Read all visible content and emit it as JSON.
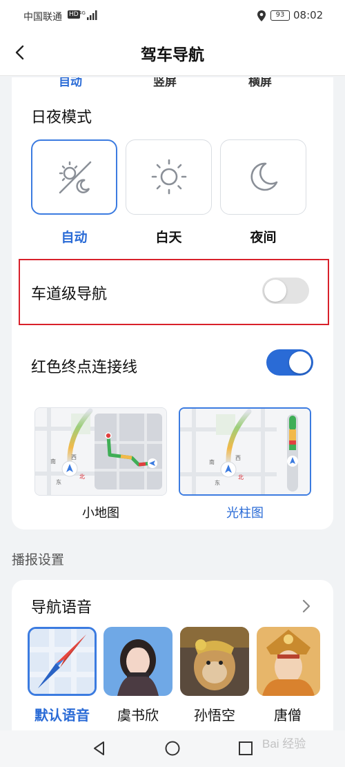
{
  "status_bar": {
    "carrier": "中国联通",
    "hd": "HD",
    "battery": "93",
    "time": "08:02"
  },
  "header": {
    "title": "驾车导航"
  },
  "card1": {
    "cut_labels": [
      "自动",
      "竖屏",
      "横屏"
    ],
    "day_night": {
      "title": "日夜模式",
      "options": [
        {
          "label": "自动",
          "icon": "auto-sun-moon-icon",
          "selected": true
        },
        {
          "label": "白天",
          "icon": "sun-icon",
          "selected": false
        },
        {
          "label": "夜间",
          "icon": "moon-icon",
          "selected": false
        }
      ]
    },
    "lane_nav": {
      "label": "车道级导航",
      "enabled": false
    },
    "red_line": {
      "label": "红色终点连接线",
      "enabled": true
    },
    "view_options": [
      {
        "label": "小地图",
        "selected": false
      },
      {
        "label": "光柱图",
        "selected": true
      }
    ],
    "map_labels": {
      "south": "南",
      "west": "西",
      "east": "东",
      "north": "北"
    }
  },
  "broadcast": {
    "heading": "播报设置"
  },
  "voice": {
    "title": "导航语音",
    "items": [
      {
        "label": "默认语音",
        "selected": true
      },
      {
        "label": "虞书欣",
        "selected": false
      },
      {
        "label": "孙悟空",
        "selected": false
      },
      {
        "label": "唐僧",
        "selected": false
      }
    ]
  },
  "watermark": "Bai 经验",
  "colors": {
    "accent": "#2a6bd6",
    "highlight": "#d8202a",
    "toggle_off": "#e3e3e3"
  }
}
